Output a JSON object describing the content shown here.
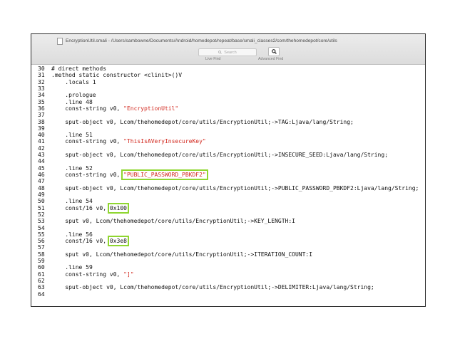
{
  "window": {
    "title": "EncryptionUtil.smali - /Users/sambowne/Documents/Android/homedepot/repeat/base/smali_classes2/com/thehomedepot/core/utils"
  },
  "toolbar": {
    "search_placeholder": "Search",
    "live_find_label": "Live Find",
    "advanced_find_label": "Advanced Find",
    "search_icon": "magnifier-icon"
  },
  "colors": {
    "string_literal": "#d2281e",
    "highlight_box": "#8fd630"
  },
  "code": {
    "lines": [
      {
        "num": "30",
        "pre": "# direct methods"
      },
      {
        "num": "31",
        "pre": ".method static constructor <clinit>()V"
      },
      {
        "num": "32",
        "pre": "    .locals 1"
      },
      {
        "num": "33",
        "pre": ""
      },
      {
        "num": "34",
        "pre": "    .prologue"
      },
      {
        "num": "35",
        "pre": "    .line 48"
      },
      {
        "num": "36",
        "pre": "    const-string v0, ",
        "str": "\"EncryptionUtil\""
      },
      {
        "num": "37",
        "pre": ""
      },
      {
        "num": "38",
        "pre": "    sput-object v0, Lcom/thehomedepot/core/utils/EncryptionUtil;->TAG:Ljava/lang/String;"
      },
      {
        "num": "39",
        "pre": ""
      },
      {
        "num": "40",
        "pre": "    .line 51"
      },
      {
        "num": "41",
        "pre": "    const-string v0, ",
        "str": "\"ThisIsAVeryInsecureKey\""
      },
      {
        "num": "42",
        "pre": ""
      },
      {
        "num": "43",
        "pre": "    sput-object v0, Lcom/thehomedepot/core/utils/EncryptionUtil;->INSECURE_SEED:Ljava/lang/String;"
      },
      {
        "num": "44",
        "pre": ""
      },
      {
        "num": "45",
        "pre": "    .line 52"
      },
      {
        "num": "46",
        "pre": "    const-string v0, ",
        "str": "\"PUBLIC_PASSWORD_PBKDF2\"",
        "highlight": true
      },
      {
        "num": "47",
        "pre": ""
      },
      {
        "num": "48",
        "pre": "    sput-object v0, Lcom/thehomedepot/core/utils/EncryptionUtil;->PUBLIC_PASSWORD_PBKDF2:Ljava/lang/String;"
      },
      {
        "num": "49",
        "pre": ""
      },
      {
        "num": "50",
        "pre": "    .line 54"
      },
      {
        "num": "51",
        "pre": "    const/16 v0, ",
        "val": "0x100",
        "highlight": true
      },
      {
        "num": "52",
        "pre": ""
      },
      {
        "num": "53",
        "pre": "    sput v0, Lcom/thehomedepot/core/utils/EncryptionUtil;->KEY_LENGTH:I"
      },
      {
        "num": "54",
        "pre": ""
      },
      {
        "num": "55",
        "pre": "    .line 56"
      },
      {
        "num": "56",
        "pre": "    const/16 v0, ",
        "val": "0x3e8",
        "highlight": true
      },
      {
        "num": "57",
        "pre": ""
      },
      {
        "num": "58",
        "pre": "    sput v0, Lcom/thehomedepot/core/utils/EncryptionUtil;->ITERATION_COUNT:I"
      },
      {
        "num": "59",
        "pre": ""
      },
      {
        "num": "60",
        "pre": "    .line 59"
      },
      {
        "num": "61",
        "pre": "    const-string v0, ",
        "str": "\"]\""
      },
      {
        "num": "62",
        "pre": ""
      },
      {
        "num": "63",
        "pre": "    sput-object v0, Lcom/thehomedepot/core/utils/EncryptionUtil;->DELIMITER:Ljava/lang/String;"
      },
      {
        "num": "64",
        "pre": ""
      }
    ]
  }
}
